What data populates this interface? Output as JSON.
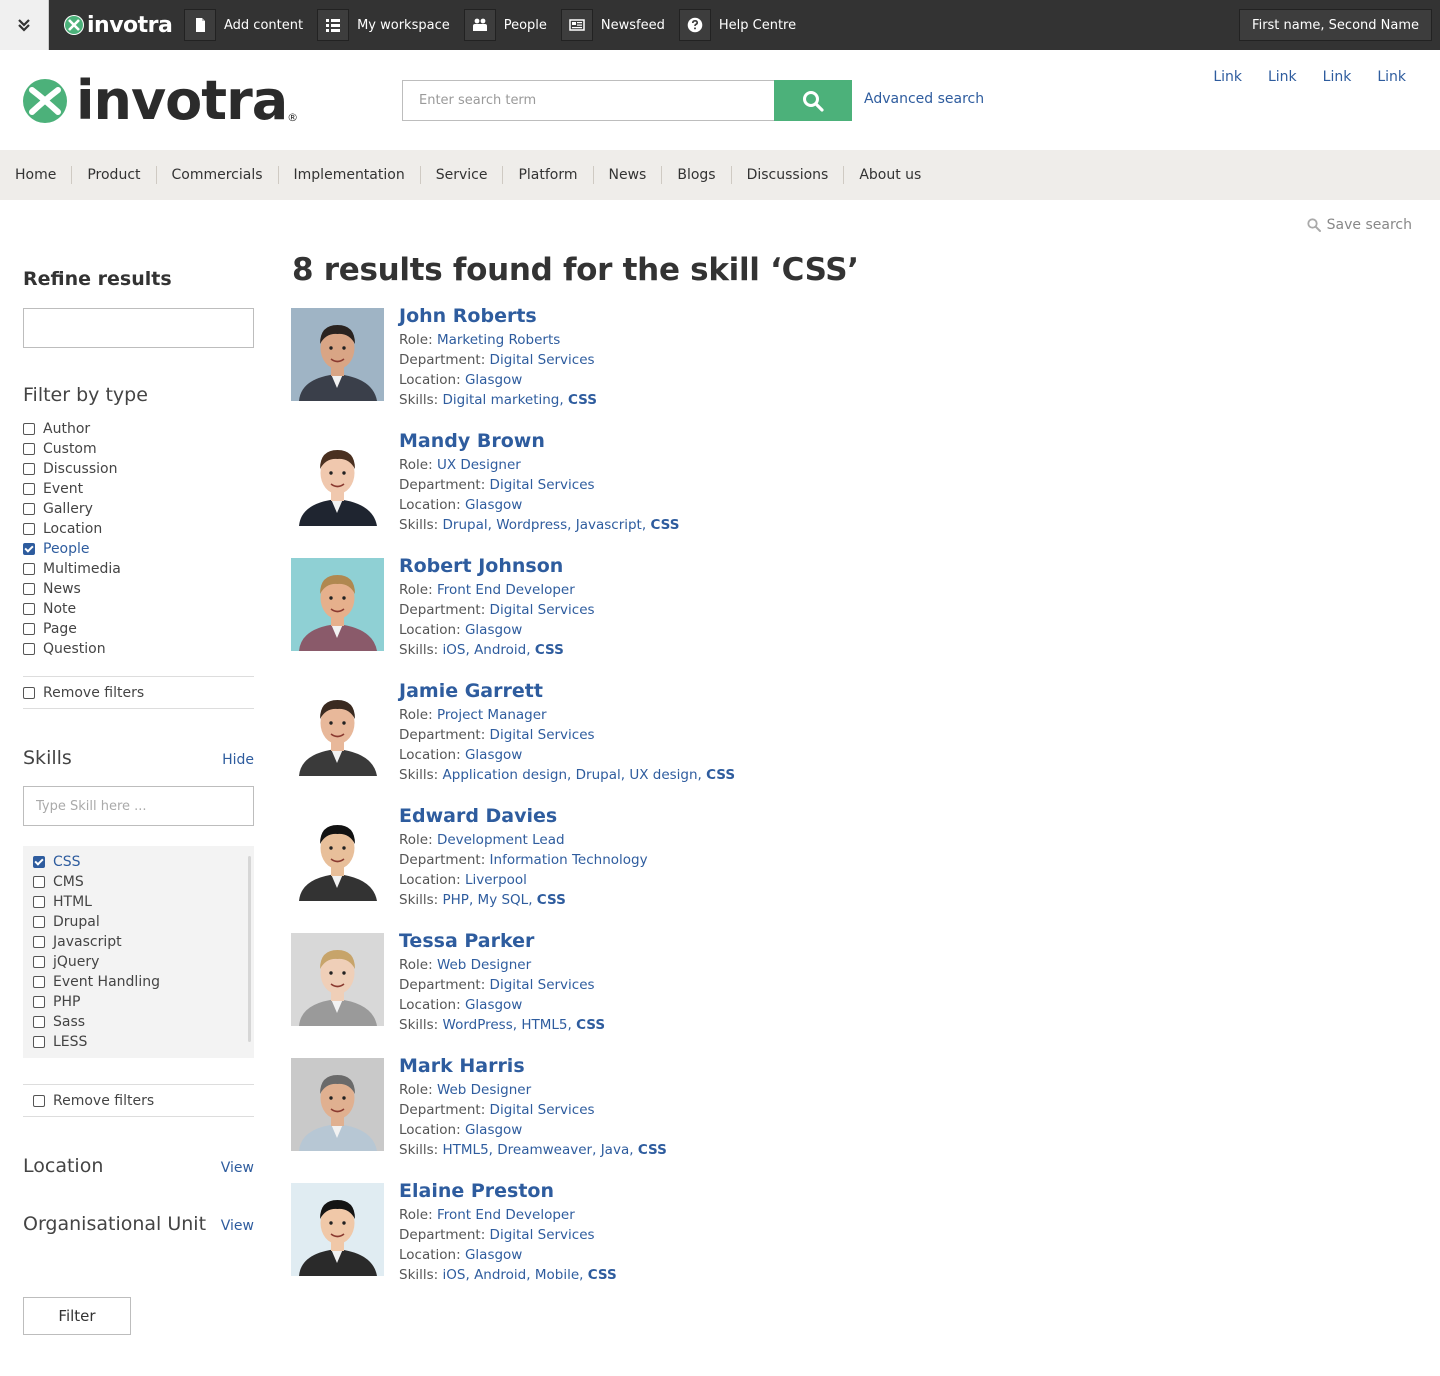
{
  "topbar": {
    "brand": "invotra",
    "menu": [
      {
        "label": "Add content",
        "icon": "document-icon"
      },
      {
        "label": "My workspace",
        "icon": "list-icon"
      },
      {
        "label": "People",
        "icon": "people-icon"
      },
      {
        "label": "Newsfeed",
        "icon": "newspaper-icon"
      },
      {
        "label": "Help Centre",
        "icon": "help-icon"
      }
    ],
    "user": "First name, Second Name"
  },
  "header": {
    "logo_text": "invotra",
    "logo_reg": "®",
    "search_placeholder": "Enter search term",
    "advanced_search": "Advanced search",
    "links": [
      "Link",
      "Link",
      "Link",
      "Link"
    ]
  },
  "nav": [
    "Home",
    "Product",
    "Commercials",
    "Implementation",
    "Service",
    "Platform",
    "News",
    "Blogs",
    "Discussions",
    "About us"
  ],
  "save_search": "Save search",
  "sidebar": {
    "refine_title": "Refine results",
    "filter_type_title": "Filter by type",
    "types": [
      {
        "label": "Author",
        "checked": false
      },
      {
        "label": "Custom",
        "checked": false
      },
      {
        "label": "Discussion",
        "checked": false
      },
      {
        "label": "Event",
        "checked": false
      },
      {
        "label": "Gallery",
        "checked": false
      },
      {
        "label": "Location",
        "checked": false
      },
      {
        "label": "People",
        "checked": true
      },
      {
        "label": "Multimedia",
        "checked": false
      },
      {
        "label": "News",
        "checked": false
      },
      {
        "label": "Note",
        "checked": false
      },
      {
        "label": "Page",
        "checked": false
      },
      {
        "label": "Question",
        "checked": false
      }
    ],
    "remove_filters": "Remove filters",
    "skills_title": "Skills",
    "skills_hide": "Hide",
    "skills_placeholder": "Type Skill here ...",
    "skills": [
      {
        "label": "CSS",
        "checked": true
      },
      {
        "label": "CMS",
        "checked": false
      },
      {
        "label": "HTML",
        "checked": false
      },
      {
        "label": "Drupal",
        "checked": false
      },
      {
        "label": "Javascript",
        "checked": false
      },
      {
        "label": "jQuery",
        "checked": false
      },
      {
        "label": "Event Handling",
        "checked": false
      },
      {
        "label": "PHP",
        "checked": false
      },
      {
        "label": "Sass",
        "checked": false
      },
      {
        "label": "LESS",
        "checked": false
      }
    ],
    "location_title": "Location",
    "location_view": "View",
    "org_title": "Organisational Unit",
    "org_view": "View",
    "filter_button": "Filter"
  },
  "results": {
    "title": "8 results found for the skill ‘CSS’",
    "labels": {
      "role": "Role: ",
      "department": "Department: ",
      "location": "Location: ",
      "skills": "Skills: "
    },
    "people": [
      {
        "name": "John Roberts",
        "role": "Marketing Roberts",
        "department": "Digital Services",
        "location": "Glasgow",
        "skills": [
          "Digital marketing"
        ],
        "match": "CSS",
        "skin": "#d9a585",
        "hair": "#2a2320",
        "shirt": "#3a3f4a",
        "bg": "#9fb4c5"
      },
      {
        "name": "Mandy Brown",
        "role": "UX Designer",
        "department": "Digital Services",
        "location": "Glasgow",
        "skills": [
          "Drupal",
          "Wordpress",
          "Javascript"
        ],
        "match": "CSS",
        "skin": "#f0c8ae",
        "hair": "#4a3020",
        "shirt": "#1f2530",
        "bg": "#ffffff"
      },
      {
        "name": "Robert Johnson",
        "role": "Front End Developer",
        "department": "Digital Services",
        "location": "Glasgow",
        "skills": [
          "iOS",
          "Android"
        ],
        "match": "CSS",
        "skin": "#e6b08c",
        "hair": "#b08850",
        "shirt": "#8a5a6a",
        "bg": "#8fd0d4"
      },
      {
        "name": "Jamie Garrett",
        "role": "Project Manager",
        "department": "Digital Services",
        "location": "Glasgow",
        "skills": [
          "Application design",
          "Drupal",
          "UX design"
        ],
        "match": "CSS",
        "skin": "#e8b89a",
        "hair": "#3a2a20",
        "shirt": "#3a3a3a",
        "bg": "#ffffff"
      },
      {
        "name": "Edward Davies",
        "role": "Development Lead",
        "department": "Information Technology",
        "location": "Liverpool",
        "skills": [
          "PHP",
          "My SQL"
        ],
        "match": "CSS",
        "skin": "#e8bf9a",
        "hair": "#121212",
        "shirt": "#333333",
        "bg": "#ffffff"
      },
      {
        "name": "Tessa Parker",
        "role": "Web Designer",
        "department": "Digital Services",
        "location": "Glasgow",
        "skills": [
          "WordPress",
          "HTML5"
        ],
        "match": "CSS",
        "skin": "#efcfb8",
        "hair": "#c7a46a",
        "shirt": "#9a9a9a",
        "bg": "#d8d8d8"
      },
      {
        "name": "Mark Harris",
        "role": "Web Designer",
        "department": "Digital Services",
        "location": "Glasgow",
        "skills": [
          "HTML5",
          "Dreamweaver",
          "Java"
        ],
        "match": "CSS",
        "skin": "#e0b090",
        "hair": "#6a6a6a",
        "shirt": "#b7c7d4",
        "bg": "#c9c9c9"
      },
      {
        "name": "Elaine Preston",
        "role": "Front End Developer",
        "department": "Digital Services",
        "location": "Glasgow",
        "skills": [
          "iOS",
          "Android",
          "Mobile"
        ],
        "match": "CSS",
        "skin": "#f0c8a8",
        "hair": "#141414",
        "shirt": "#2a2a2a",
        "bg": "#e0ecf2"
      }
    ]
  }
}
